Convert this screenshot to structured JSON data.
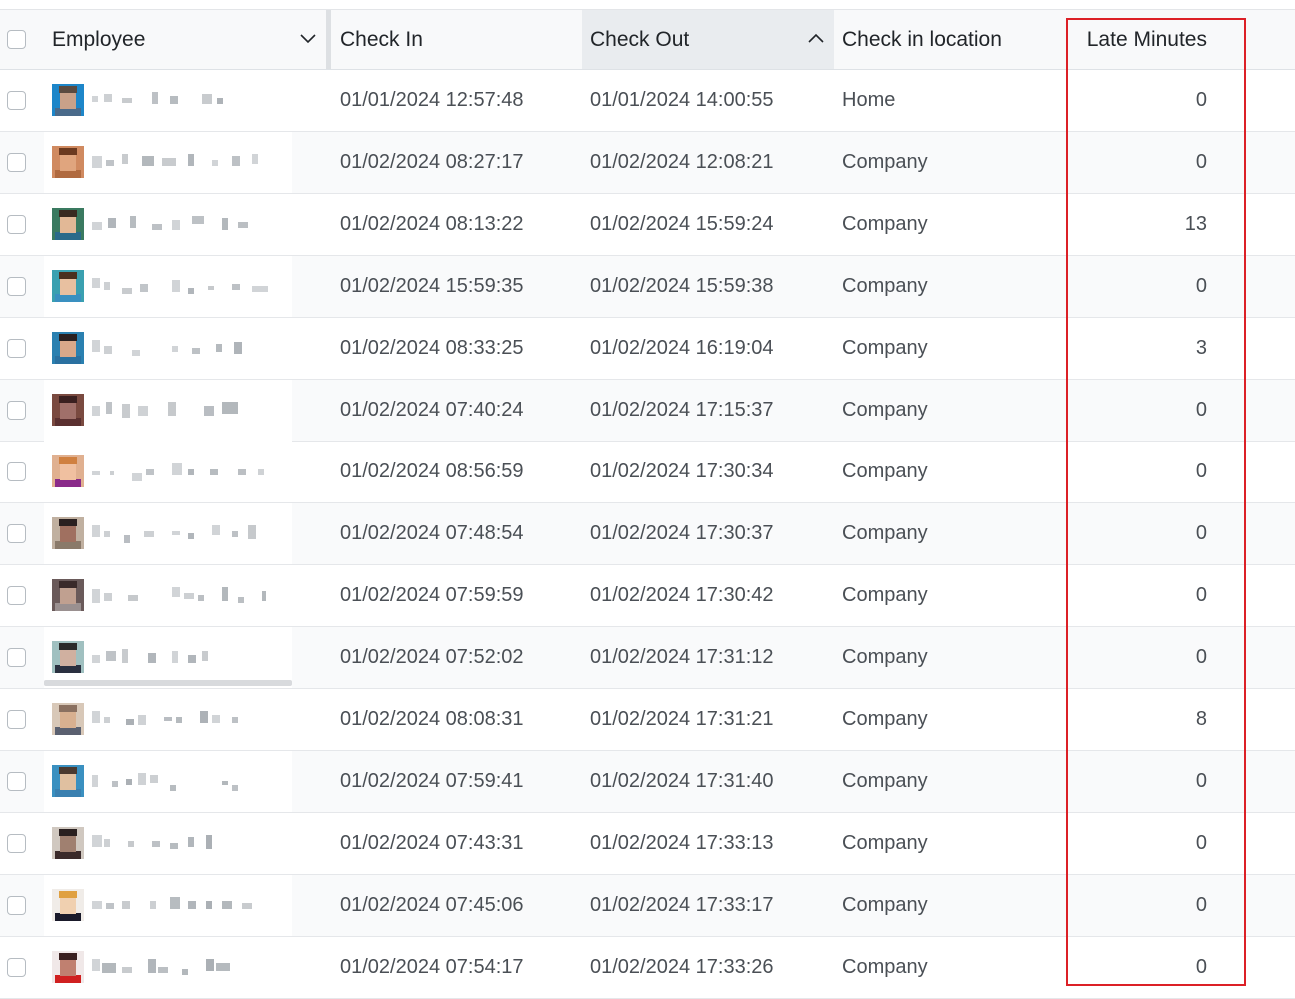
{
  "columns": {
    "employee": "Employee",
    "check_in": "Check In",
    "check_out": "Check Out",
    "location": "Check in location",
    "late": "Late Minutes"
  },
  "rows": [
    {
      "check_in": "01/01/2024 12:57:48",
      "check_out": "01/01/2024 14:00:55",
      "location": "Home",
      "late": "0",
      "avatar": {
        "bg": "#1d86c9",
        "skin": "#c9a189",
        "hair": "#5a4a40",
        "shirt": "#4a6a8a"
      }
    },
    {
      "check_in": "01/02/2024 08:27:17",
      "check_out": "01/02/2024 12:08:21",
      "location": "Company",
      "late": "0",
      "avatar": {
        "bg": "#d08a60",
        "skin": "#e0a57e",
        "hair": "#6b3a20",
        "shirt": "#b06a40"
      }
    },
    {
      "check_in": "01/02/2024 08:13:22",
      "check_out": "01/02/2024 15:59:24",
      "location": "Company",
      "late": "13",
      "avatar": {
        "bg": "#3a7a60",
        "skin": "#e2b896",
        "hair": "#3a2a20",
        "shirt": "#2a6a8a"
      }
    },
    {
      "check_in": "01/02/2024 15:59:35",
      "check_out": "01/02/2024 15:59:38",
      "location": "Company",
      "late": "0",
      "avatar": {
        "bg": "#3aa0b0",
        "skin": "#e8c0a0",
        "hair": "#4a3020",
        "shirt": "#3a90c0"
      }
    },
    {
      "check_in": "01/02/2024 08:33:25",
      "check_out": "01/02/2024 16:19:04",
      "location": "Company",
      "late": "3",
      "avatar": {
        "bg": "#2a80b0",
        "skin": "#d9a88a",
        "hair": "#2a2020",
        "shirt": "#2a70a0"
      }
    },
    {
      "check_in": "01/02/2024 07:40:24",
      "check_out": "01/02/2024 17:15:37",
      "location": "Company",
      "late": "0",
      "avatar": {
        "bg": "#7a4a40",
        "skin": "#a0706a",
        "hair": "#3a2020",
        "shirt": "#5a3030"
      }
    },
    {
      "check_in": "01/02/2024 08:56:59",
      "check_out": "01/02/2024 17:30:34",
      "location": "Company",
      "late": "0",
      "avatar": {
        "bg": "#e0b090",
        "skin": "#f0c0a0",
        "hair": "#d08040",
        "shirt": "#8a2a8a"
      }
    },
    {
      "check_in": "01/02/2024 07:48:54",
      "check_out": "01/02/2024 17:30:37",
      "location": "Company",
      "late": "0",
      "avatar": {
        "bg": "#c0b0a0",
        "skin": "#a07060",
        "hair": "#2a2020",
        "shirt": "#8a7a6a"
      }
    },
    {
      "check_in": "01/02/2024 07:59:59",
      "check_out": "01/02/2024 17:30:42",
      "location": "Company",
      "late": "0",
      "avatar": {
        "bg": "#6a5a5a",
        "skin": "#c0a090",
        "hair": "#3a2a2a",
        "shirt": "#9a9090"
      }
    },
    {
      "check_in": "01/02/2024 07:52:02",
      "check_out": "01/02/2024 17:31:12",
      "location": "Company",
      "late": "0",
      "avatar": {
        "bg": "#a0c0c0",
        "skin": "#d0b0a0",
        "hair": "#2a2a2a",
        "shirt": "#2a3040"
      }
    },
    {
      "check_in": "01/02/2024 08:08:31",
      "check_out": "01/02/2024 17:31:21",
      "location": "Company",
      "late": "8",
      "avatar": {
        "bg": "#d8c8b8",
        "skin": "#d8b090",
        "hair": "#8a7060",
        "shirt": "#5a6070"
      }
    },
    {
      "check_in": "01/02/2024 07:59:41",
      "check_out": "01/02/2024 17:31:40",
      "location": "Company",
      "late": "0",
      "avatar": {
        "bg": "#3a90c0",
        "skin": "#e0c0a0",
        "hair": "#4a3a30",
        "shirt": "#3a80b0"
      }
    },
    {
      "check_in": "01/02/2024 07:43:31",
      "check_out": "01/02/2024 17:33:13",
      "location": "Company",
      "late": "0",
      "avatar": {
        "bg": "#d0c8c0",
        "skin": "#a08070",
        "hair": "#2a2020",
        "shirt": "#3a2a2a"
      }
    },
    {
      "check_in": "01/02/2024 07:45:06",
      "check_out": "01/02/2024 17:33:17",
      "location": "Company",
      "late": "0",
      "avatar": {
        "bg": "#f0ece8",
        "skin": "#f0d0b0",
        "hair": "#e0a040",
        "shirt": "#1a1a2a"
      }
    },
    {
      "check_in": "01/02/2024 07:54:17",
      "check_out": "01/02/2024 17:33:26",
      "location": "Company",
      "late": "0",
      "avatar": {
        "bg": "#f0e8e8",
        "skin": "#c08070",
        "hair": "#3a2020",
        "shirt": "#d02020"
      }
    }
  ]
}
